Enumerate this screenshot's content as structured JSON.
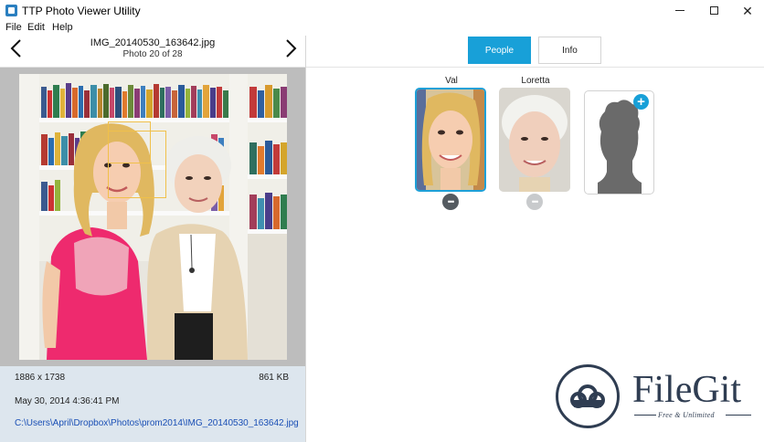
{
  "window": {
    "title": "TTP Photo Viewer Utility",
    "icons": {
      "app": "photo-app-icon",
      "minimize": "minimize-icon",
      "maximize": "maximize-icon",
      "close": "close-icon"
    },
    "close_glyph": "✕"
  },
  "menu": {
    "items": [
      "File",
      "Edit",
      "Help"
    ]
  },
  "viewer": {
    "filename": "IMG_20140530_163642.jpg",
    "counter": "Photo 20 of 28",
    "prev_icon": "chevron-left-icon",
    "next_icon": "chevron-right-icon"
  },
  "file_info": {
    "dimensions": "1886 x 1738",
    "size": "861 KB",
    "date": "May 30, 2014 4:36:41 PM",
    "path": "C:\\Users\\April\\Dropbox\\Photos\\prom2014\\IMG_20140530_163642.jpg"
  },
  "tabs": [
    {
      "label": "People",
      "active": true
    },
    {
      "label": "Info",
      "active": false
    }
  ],
  "people": [
    {
      "name": "Val",
      "selected": true,
      "more_glyph": "•••"
    },
    {
      "name": "Loretta",
      "selected": false,
      "more_glyph": "•••"
    }
  ],
  "add_person": {
    "icon": "silhouette-icon",
    "plus": "+"
  },
  "watermark": {
    "brand": "FileGit",
    "tagline": "Free & Unlimited",
    "logo_icon": "cloud-logo-icon"
  },
  "colors": {
    "accent": "#18a0d8",
    "face_box": "#f0c04a",
    "info_panel": "#dde6ee",
    "watermark": "#2f3d52"
  }
}
